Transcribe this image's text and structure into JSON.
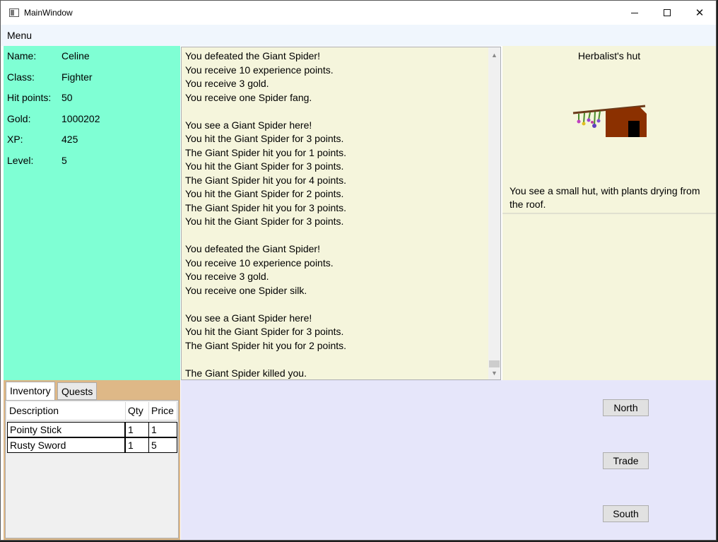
{
  "window": {
    "title": "MainWindow"
  },
  "menu": {
    "label": "Menu"
  },
  "player": {
    "stats": [
      {
        "label": "Name:",
        "value": "Celine"
      },
      {
        "label": "Class:",
        "value": "Fighter"
      },
      {
        "label": "Hit points:",
        "value": "50"
      },
      {
        "label": "Gold:",
        "value": "1000202"
      },
      {
        "label": "XP:",
        "value": "425"
      },
      {
        "label": "Level:",
        "value": "5"
      }
    ]
  },
  "log": {
    "lines": [
      "You defeated the Giant Spider!",
      "You receive 10 experience points.",
      "You receive 3 gold.",
      "You receive one Spider fang.",
      "",
      "You see a Giant Spider here!",
      "You hit the Giant Spider for 3 points.",
      "The Giant Spider hit you for 1 points.",
      "You hit the Giant Spider for 3 points.",
      "The Giant Spider hit you for 4 points.",
      "You hit the Giant Spider for 2 points.",
      "The Giant Spider hit you for 3 points.",
      "You hit the Giant Spider for 3 points.",
      "",
      "You defeated the Giant Spider!",
      "You receive 10 experience points.",
      "You receive 3 gold.",
      "You receive one Spider silk.",
      "",
      "You see a Giant Spider here!",
      "You hit the Giant Spider for 3 points.",
      "The Giant Spider hit you for 2 points.",
      "",
      "The Giant Spider killed you."
    ]
  },
  "location": {
    "name": "Herbalist's hut",
    "description": "You see a small hut, with plants drying from the roof.",
    "image_icon": "hut-icon"
  },
  "tabs": {
    "inventory": "Inventory",
    "quests": "Quests"
  },
  "inventory": {
    "columns": [
      "Description",
      "Qty",
      "Price"
    ],
    "rows": [
      {
        "description": "Pointy Stick",
        "qty": "1",
        "price": "1"
      },
      {
        "description": "Rusty Sword",
        "qty": "1",
        "price": "5"
      }
    ]
  },
  "actions": {
    "north": "North",
    "trade": "Trade",
    "south": "South"
  },
  "colors": {
    "stats_bg": "#7fffd4",
    "log_bg": "#f5f5dc",
    "tabs_bg": "#deb887",
    "actions_bg": "#e6e6fa"
  }
}
